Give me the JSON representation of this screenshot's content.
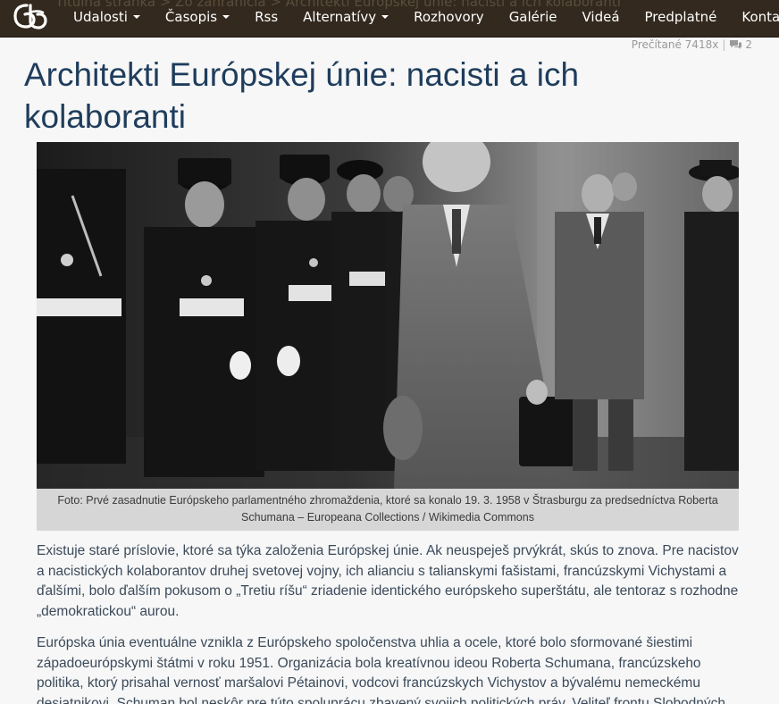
{
  "header": {
    "logo_alt": "dav dva logo",
    "breadcrumb_ghost": "Titulná stránka  >  Zo zahraničia  >  Architekti Európskej únie: nacisti a ich kolaboranti",
    "nav": [
      {
        "label": "Udalosti",
        "dropdown": true
      },
      {
        "label": "Časopis",
        "dropdown": true
      },
      {
        "label": "Rss",
        "dropdown": false
      },
      {
        "label": "Alternatívy",
        "dropdown": true
      },
      {
        "label": "Rozhovory",
        "dropdown": false
      },
      {
        "label": "Galérie",
        "dropdown": false
      },
      {
        "label": "Videá",
        "dropdown": false
      },
      {
        "label": "Predplatné",
        "dropdown": false
      },
      {
        "label": "Kontakt",
        "dropdown": false
      }
    ]
  },
  "article": {
    "stats": {
      "read_label": "Prečítané 7418x",
      "separator": "|",
      "comments": "2",
      "comment_icon": "comments-icon"
    },
    "title": "Architekti Európskej únie: nacisti a ich kolaboranti",
    "image": {
      "caption": "Foto: Prvé zasadnutie Európskeho parlamentného zhromaždenia, ktoré sa konalo 19. 3. 1958 v Štrasburgu za predsedníctva Roberta Schumana – Europeana Collections / Wikimedia Commons"
    },
    "paragraphs": [
      "Existuje staré príslovie, ktoré sa týka založenia Európskej únie. Ak neuspeješ prvýkrát, skús to znova. Pre nacistov a nacistických kolaborantov druhej svetovej vojny, ich alianciu s talianskymi fašistami, francúzskymi Vichystami a ďalšími, bolo ďalším pokusom o „Tretiu ríšu“ zriadenie identického európskeho superštátu, ale tentoraz s rozhodne „demokratickou“ aurou.",
      "Európska únia eventuálne vznikla z Európskeho spoločenstva uhlia a ocele, ktoré bolo sformované šiestimi západoeurópskymi štátmi v roku 1951. Organizácia bola kreatívnou ideou Roberta Schumana, francúzskeho politika, ktorý prisahal vernosť maršalovi Pétainovi, vodcovi francúzskych Vichystov a bývalému nemeckému desiatnikovi. Schuman bol neskôr pre túto spoluprácu zbavený svojich politických práv. Veliteľ frontu Slobodných"
    ]
  }
}
